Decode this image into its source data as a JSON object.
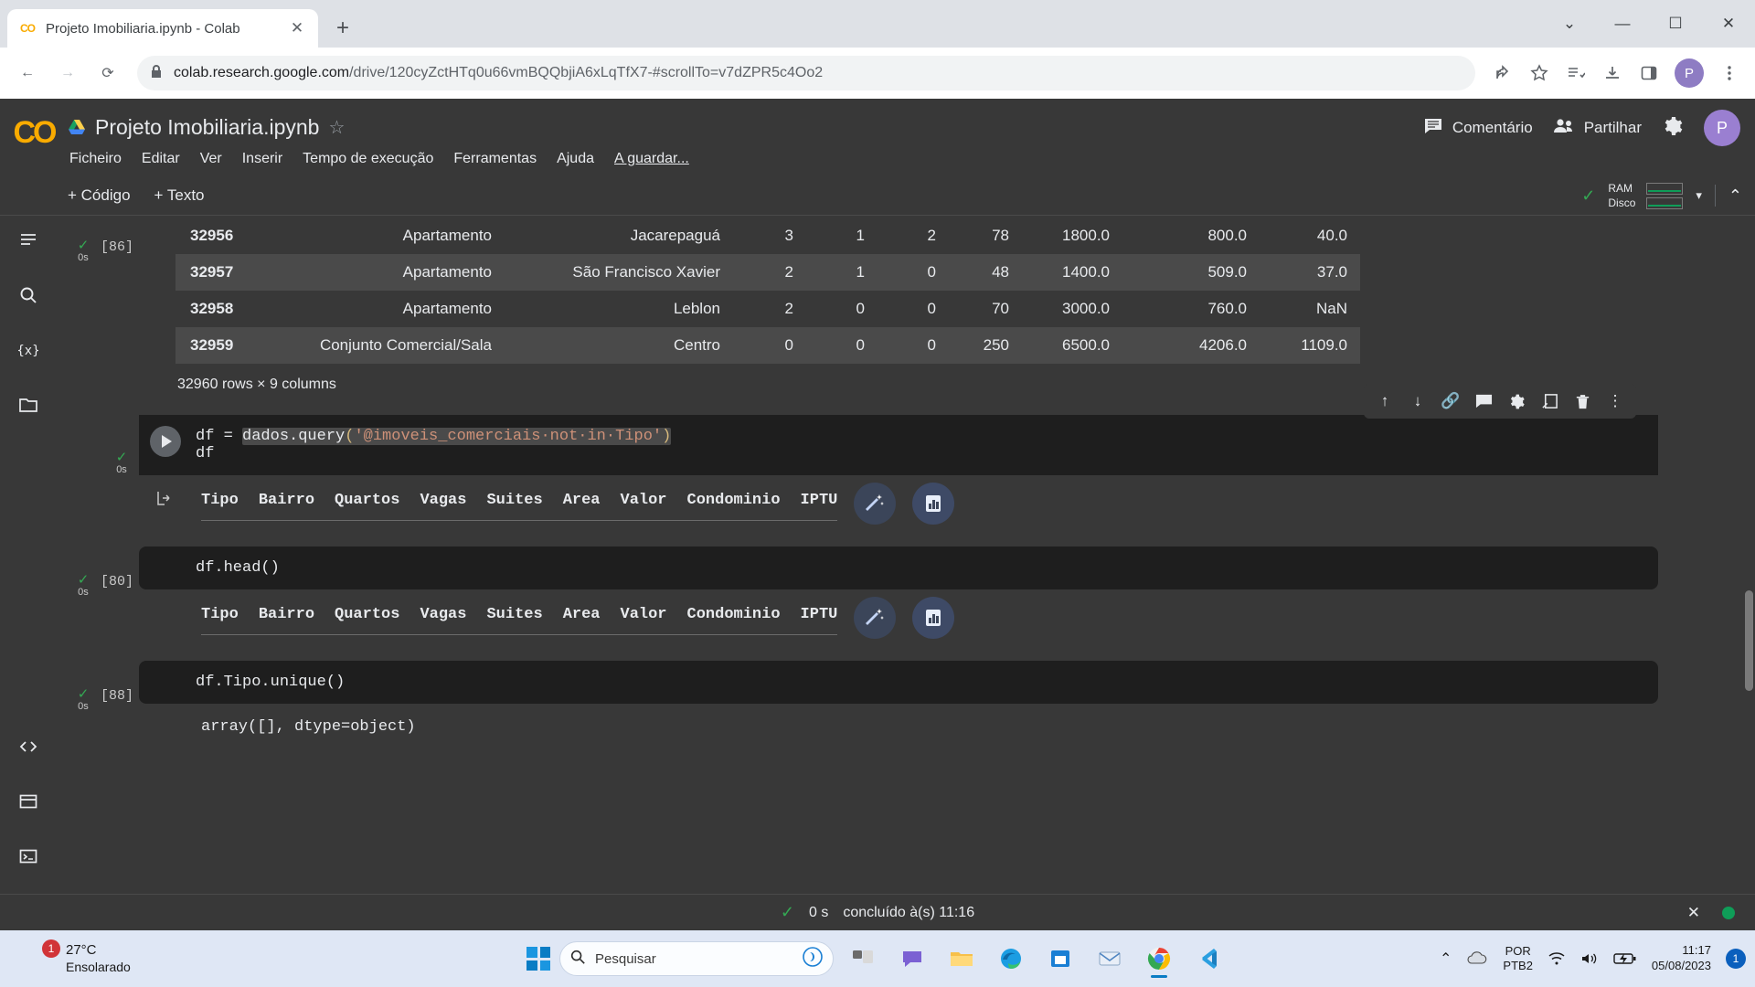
{
  "browser": {
    "tab": {
      "title": "Projeto Imobiliaria.ipynb - Colab",
      "favicon": "colab-icon",
      "close": "✕"
    },
    "new_tab": "+",
    "window_controls": {
      "minimize": "—",
      "maximize": "☐",
      "close": "✕",
      "chevron": "⌄"
    },
    "nav": {
      "back": "←",
      "forward": "→",
      "reload": "⟳"
    },
    "omnibox": {
      "lock_icon": "lock-icon",
      "url_host": "colab.research.google.com",
      "url_path": "/drive/120cyZctHTq0u66vmBQQbjiA6xLqTfX7-#scrollTo=v7dZPR5c4Oo2"
    },
    "toolbar_icons": [
      "share-icon",
      "bookmark-star-icon",
      "reading-list-icon",
      "downloads-icon",
      "sidepanel-icon",
      "more-vertical-icon"
    ],
    "profile_initial": "P"
  },
  "colab": {
    "logo": "CO",
    "notebook_title": "Projeto Imobiliaria.ipynb",
    "star_icon": "☆",
    "menu": [
      "Ficheiro",
      "Editar",
      "Ver",
      "Inserir",
      "Tempo de execução",
      "Ferramentas",
      "Ajuda"
    ],
    "saving_label": "A guardar...",
    "comment_button": "Comentário",
    "share_button": "Partilhar",
    "settings_icon": "gear-icon",
    "avatar_initial": "P",
    "subbar": {
      "add_code": "+ Código",
      "add_text": "+ Texto"
    },
    "resources": {
      "ram_label": "RAM",
      "disk_label": "Disco",
      "caret": "▾",
      "collapse": "⌃"
    },
    "rail_icons": [
      "table-of-contents-icon",
      "search-icon",
      "variables-icon",
      "files-icon",
      "code-snippets-icon",
      "terminal-panel-icon",
      "terminal-icon"
    ],
    "status": {
      "check": "✓",
      "elapsed": "0 s",
      "message": "concluído à(s) 11:16",
      "close": "✕"
    }
  },
  "cells": [
    {
      "name": "dataframe-output-cell",
      "label": "[86]",
      "elapsed": "0s",
      "check": "✓",
      "caption": "32960 rows × 9 columns",
      "rows": [
        {
          "index": "32956",
          "tipo": "Apartamento",
          "bairro": "Jacarepaguá",
          "quartos": "3",
          "vagas": "1",
          "suites": "2",
          "area": "78",
          "valor": "1800.0",
          "condominio": "800.0",
          "iptu": "40.0"
        },
        {
          "index": "32957",
          "tipo": "Apartamento",
          "bairro": "São Francisco Xavier",
          "quartos": "2",
          "vagas": "1",
          "suites": "0",
          "area": "48",
          "valor": "1400.0",
          "condominio": "509.0",
          "iptu": "37.0"
        },
        {
          "index": "32958",
          "tipo": "Apartamento",
          "bairro": "Leblon",
          "quartos": "2",
          "vagas": "0",
          "suites": "0",
          "area": "70",
          "valor": "3000.0",
          "condominio": "760.0",
          "iptu": "NaN"
        },
        {
          "index": "32959",
          "tipo": "Conjunto Comercial/Sala",
          "bairro": "Centro",
          "quartos": "0",
          "vagas": "0",
          "suites": "0",
          "area": "250",
          "valor": "6500.0",
          "condominio": "4206.0",
          "iptu": "1109.0"
        }
      ]
    },
    {
      "name": "query-code-cell",
      "check": "✓",
      "elapsed": "0s",
      "code_line1_prefix": "df = ",
      "code_fn": "dados.query",
      "code_open": "(",
      "code_string": "'@imoveis_comerciais·not·in·Tipo'",
      "code_close": ")",
      "code_line2": "df",
      "toolbar_icons": [
        "move-cell-up-icon",
        "move-cell-down-icon",
        "link-icon",
        "comment-icon",
        "settings-icon",
        "mirror-cell-icon",
        "delete-cell-icon",
        "more-vertical-icon"
      ],
      "output_columns": [
        "Tipo",
        "Bairro",
        "Quartos",
        "Vagas",
        "Suites",
        "Area",
        "Valor",
        "Condominio",
        "IPTU"
      ],
      "output_arrow": "⬚",
      "magic_button": "magic-wand-icon",
      "chart_button": "chart-bars-icon"
    },
    {
      "name": "head-code-cell",
      "label": "[80]",
      "check": "✓",
      "elapsed": "0s",
      "code": "df.head()",
      "output_columns": [
        "Tipo",
        "Bairro",
        "Quartos",
        "Vagas",
        "Suites",
        "Area",
        "Valor",
        "Condominio",
        "IPTU"
      ],
      "magic_button": "magic-wand-icon",
      "chart_button": "chart-bars-icon"
    },
    {
      "name": "unique-code-cell",
      "label": "[88]",
      "check": "✓",
      "elapsed": "0s",
      "code": "df.Tipo.unique()",
      "output_text": "array([], dtype=object)"
    }
  ],
  "taskbar": {
    "weather": {
      "temp": "27°C",
      "desc": "Ensolarado",
      "badge": "1",
      "icon": "sun-icon"
    },
    "start_icon": "windows-logo-icon",
    "search_placeholder": "Pesquisar",
    "search_icon": "search-icon",
    "copilot_icon": "copilot-icon",
    "apps": [
      "task-view-icon",
      "chat-icon",
      "file-explorer-icon",
      "edge-icon",
      "microsoft-store-icon",
      "mail-icon",
      "chrome-icon",
      "vscode-icon"
    ],
    "tray": {
      "overflow": "⌃",
      "onedrive_icon": "cloud-icon",
      "lang_line1": "POR",
      "lang_line2": "PTB2",
      "wifi_icon": "wifi-icon",
      "volume_icon": "speaker-icon",
      "battery_icon": "battery-charging-icon",
      "time": "11:17",
      "date": "05/08/2023",
      "notification_count": "1"
    }
  }
}
